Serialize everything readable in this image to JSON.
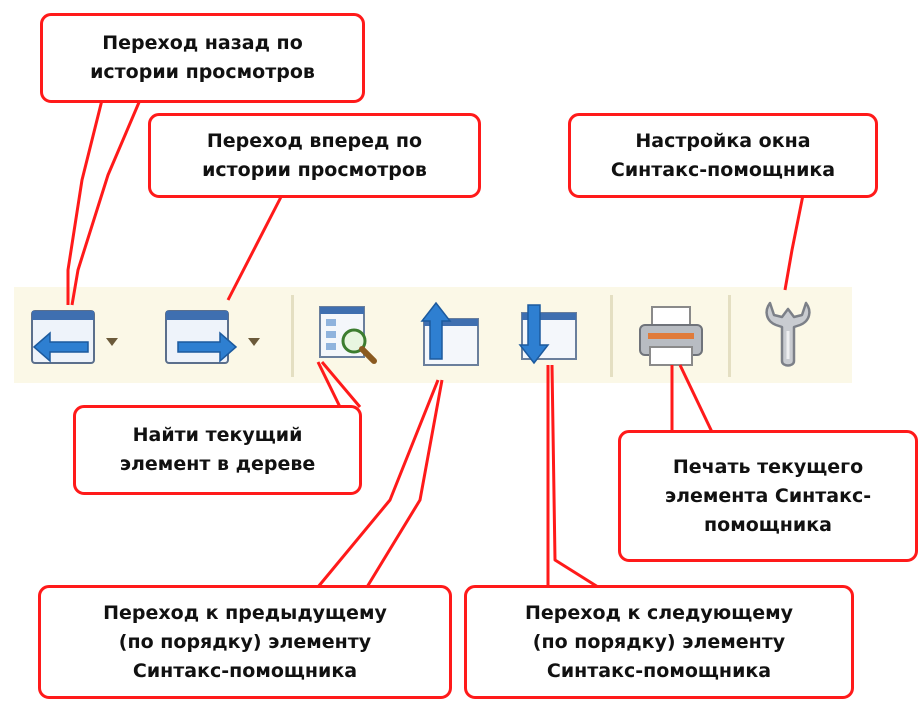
{
  "callouts": {
    "back": "Переход назад по\nистории просмотров",
    "forward": "Переход вперед по\nистории просмотров",
    "settings": "Настройка окна\nСинтакс-помощника",
    "find": "Найти текущий\nэлемент в дереве",
    "print": "Печать текущего\nэлемента Синтакс-\nпомощника",
    "prev": "Переход к предыдущему\n(по порядку) элементу\nСинтакс-помощника",
    "next": "Переход к следующему\n(по порядку) элементу\nСинтакс-помощника"
  },
  "toolbar": {
    "buttons": [
      "back-icon",
      "forward-icon",
      "find-in-tree-icon",
      "previous-element-icon",
      "next-element-icon",
      "printer-icon",
      "wrench-icon"
    ]
  },
  "colors": {
    "callout_border": "#ff1a1a",
    "toolbar_bg": "#fbf8e7",
    "icon_blue": "#2e7fd1"
  }
}
